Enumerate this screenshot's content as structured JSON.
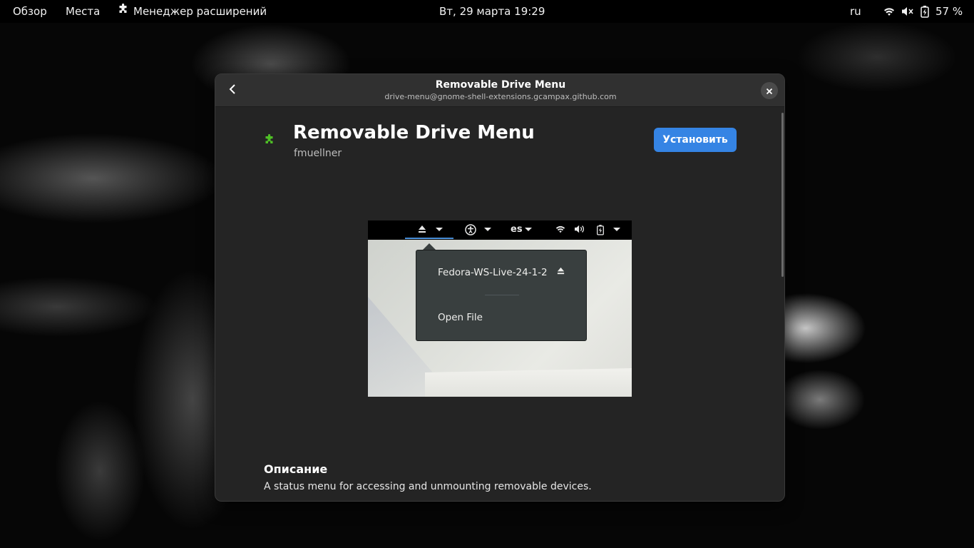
{
  "topbar": {
    "overview": "Обзор",
    "places": "Места",
    "app_name": "Менеджер расширений",
    "app_icon": "puzzle-icon",
    "clock": "Вт, 29 марта  19:29",
    "keyboard_layout": "ru",
    "status_icons": [
      "wifi-icon",
      "volume-muted-icon",
      "battery-charging-icon"
    ],
    "battery_percent": "57 %"
  },
  "dialog": {
    "title": "Removable Drive Menu",
    "subtitle": "drive-menu@gnome-shell-extensions.gcampax.github.com",
    "back_icon": "back-arrow-icon",
    "close_icon": "close-icon"
  },
  "extension": {
    "name": "Removable Drive Menu",
    "author": "fmuellner",
    "install_label": "Установить",
    "icon": "puzzle-icon",
    "accent_color": "#3584e4",
    "icon_color": "#4fbf26"
  },
  "preview": {
    "panel_language": "es",
    "panel_icons": [
      "eject-icon",
      "accessibility-icon",
      "wifi-icon",
      "volume-icon",
      "battery-icon"
    ],
    "menu_items": [
      "Fedora-WS-Live-24-1-2",
      "Open File"
    ]
  },
  "description": {
    "title": "Описание",
    "text": "A status menu for accessing and unmounting removable devices."
  }
}
